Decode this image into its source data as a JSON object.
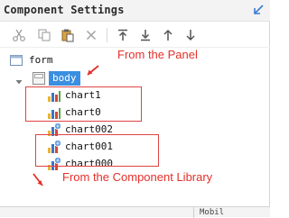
{
  "header": {
    "title": "Component Settings",
    "collapse_icon": "collapse-arrow-icon"
  },
  "toolbar": {
    "buttons": [
      {
        "name": "cut-button",
        "icon": "scissors-icon"
      },
      {
        "name": "copy-button",
        "icon": "copy-icon"
      },
      {
        "name": "paste-button",
        "icon": "paste-icon"
      },
      {
        "name": "delete-button",
        "icon": "x-icon"
      },
      {
        "name": "move-top-button",
        "icon": "arrow-to-top-icon"
      },
      {
        "name": "move-bottom-button",
        "icon": "arrow-to-bottom-icon"
      },
      {
        "name": "move-up-button",
        "icon": "arrow-up-icon"
      },
      {
        "name": "move-down-button",
        "icon": "arrow-down-icon"
      }
    ]
  },
  "tree": {
    "root": {
      "label": "form"
    },
    "body": {
      "label": "body"
    },
    "children": [
      {
        "label": "chart1",
        "source": "panel"
      },
      {
        "label": "chart0",
        "source": "panel"
      },
      {
        "label": "chart002",
        "source": "library"
      },
      {
        "label": "chart001",
        "source": "library"
      },
      {
        "label": "chart000",
        "source": "library"
      }
    ]
  },
  "annotations": {
    "from_panel": "From the Panel",
    "from_library": "From the Component Library"
  },
  "footer": {
    "tab_label": "Mobil"
  },
  "colors": {
    "annotation": "#e5302a",
    "selected": "#3b8fe0"
  }
}
